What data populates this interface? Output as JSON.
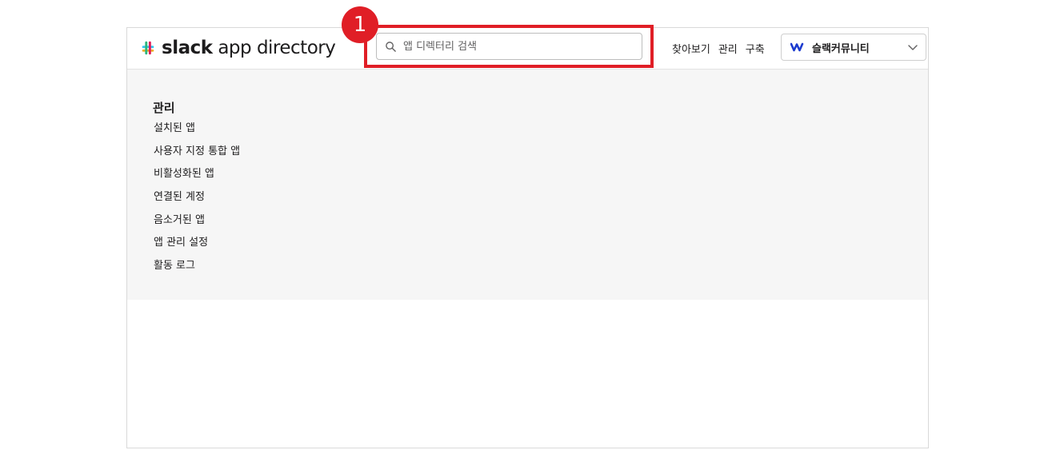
{
  "header": {
    "logo_text": "slack app directory",
    "logo_bold": "slack",
    "logo_rest": " app directory",
    "search": {
      "placeholder": "앱 디렉터리 검색"
    },
    "nav": [
      "찾아보기",
      "관리",
      "구축"
    ],
    "workspace": {
      "name": "슬랙커뮤니티"
    }
  },
  "annotation": {
    "number": "1",
    "color": "#e01e26"
  },
  "sidebar": {
    "title": "관리",
    "items": [
      "설치된 앱",
      "사용자 지정 통합 앱",
      "비활성화된 앱",
      "연결된 계정",
      "음소거된 앱",
      "앱 관리 설정",
      "활동 로그"
    ]
  },
  "icons": {
    "logo": "slack-hash-icon",
    "search": "search-icon",
    "workspace": "workspace-w-logo-icon",
    "dropdown": "chevron-down-icon"
  },
  "colors": {
    "accent": "#e01e26",
    "content_bg": "#f6f6f6",
    "workspace_logo": "#1d3ccf"
  }
}
